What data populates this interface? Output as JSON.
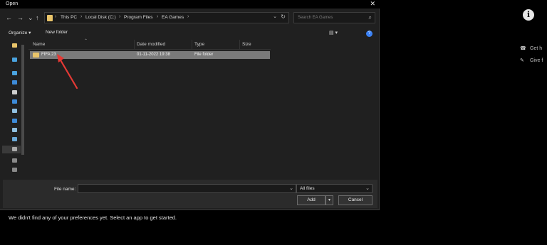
{
  "window": {
    "title": "Open",
    "close_glyph": "✕"
  },
  "nav": {
    "back_glyph": "←",
    "forward_glyph": "→",
    "recent_glyph": "⌄",
    "up_glyph": "↑",
    "breadcrumbs": [
      "This PC",
      "Local Disk (C:)",
      "Program Files",
      "EA Games"
    ],
    "separator": "›",
    "address_dropdown_glyph": "⌄",
    "refresh_glyph": "↻",
    "search_placeholder": "Search EA Games",
    "search_glyph": "⌕"
  },
  "toolbar": {
    "organize_label": "Organize ▾",
    "new_folder_label": "New folder",
    "view_glyph": "▤ ▾",
    "help_glyph": "?"
  },
  "filelist": {
    "columns": [
      "Name",
      "Date modified",
      "Type",
      "Size"
    ],
    "sort_glyph": "⌃",
    "rows": [
      {
        "name": "FIFA 23",
        "date": "01-11-2022 19:38",
        "type": "File folder",
        "size": ""
      }
    ]
  },
  "bottom": {
    "file_name_label": "File name:",
    "file_name_value": "",
    "dropdown_glyph": "⌄",
    "file_type_value": "All files",
    "add_label": "Add",
    "split_glyph": "▾",
    "cancel_label": "Cancel"
  },
  "background": {
    "message": "We didn't find any of your preferences yet. Select an app to get started.",
    "info_glyph": "i",
    "side_items": [
      {
        "icon": "help-icon",
        "glyph": "☎",
        "label": "Get h"
      },
      {
        "icon": "feedback-icon",
        "glyph": "✎",
        "label": "Give f"
      }
    ]
  },
  "colors": {
    "folder": "#e9c46a",
    "selected_row": "#7a7a7a",
    "annotation_arrow": "#e53935",
    "dialog_bg": "#202020"
  }
}
